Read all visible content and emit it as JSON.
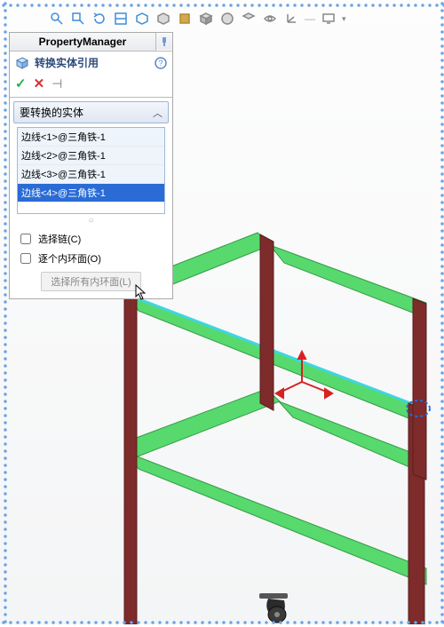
{
  "toolbar": {
    "icons": [
      "magnify",
      "hand",
      "rotate",
      "scan",
      "home",
      "section",
      "measure",
      "cube1",
      "cube2",
      "cube3",
      "eye",
      "triad",
      "monitor"
    ]
  },
  "panel": {
    "title": "PropertyManager",
    "feature_title": "转换实体引用",
    "ok_label": "✓",
    "cancel_label": "✕",
    "pin_label": "⊣",
    "section_title": "要转换的实体",
    "items": [
      "边线<1>@三角铁-1",
      "边线<2>@三角铁-1",
      "边线<3>@三角铁-1",
      "边线<4>@三角铁-1"
    ],
    "selected_index": 3,
    "chk_chain_label": "选择链(C)",
    "chk_loop_label": "逐个内环面(O)",
    "inner_btn_label": "选择所有内环面(L)"
  },
  "colors": {
    "green": "#57d96e",
    "maroon": "#7d2b2b",
    "cyan": "#3ed6e0"
  }
}
